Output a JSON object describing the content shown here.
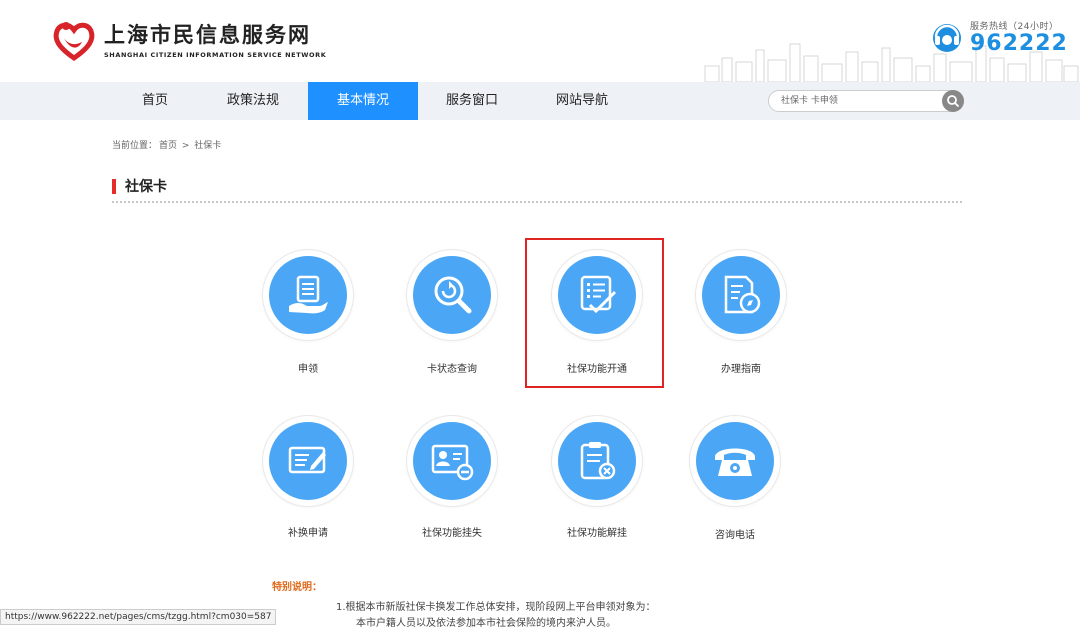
{
  "site": {
    "title_cn": "上海市民信息服务网",
    "title_en": "SHANGHAI CITIZEN INFORMATION SERVICE NETWORK",
    "hotline_label": "服务热线（24小时）",
    "hotline_number": "962222",
    "brand_color": "#1e90ff",
    "logo_color": "#d8232a"
  },
  "nav": {
    "items": [
      {
        "label": "首页",
        "active": false
      },
      {
        "label": "政策法规",
        "active": false
      },
      {
        "label": "基本情况",
        "active": true
      },
      {
        "label": "服务窗口",
        "active": false
      },
      {
        "label": "网站导航",
        "active": false
      }
    ],
    "search_placeholder": "社保卡 卡申领"
  },
  "breadcrumb": {
    "prefix": "当前位置：",
    "home": "首页",
    "sep": " > ",
    "current": "社保卡"
  },
  "section": {
    "title": "社保卡",
    "accent_color": "#e62b2b"
  },
  "services": [
    {
      "label": "申领",
      "icon": "apply-hand-icon"
    },
    {
      "label": "卡状态查询",
      "icon": "search-refresh-icon"
    },
    {
      "label": "社保功能开通",
      "icon": "document-check-icon",
      "highlighted": true
    },
    {
      "label": "办理指南",
      "icon": "guide-compass-icon"
    },
    {
      "label": "补换申请",
      "icon": "card-edit-icon"
    },
    {
      "label": "社保功能挂失",
      "icon": "id-card-minus-icon"
    },
    {
      "label": "社保功能解挂",
      "icon": "clipboard-cancel-icon"
    },
    {
      "label": "咨询电话",
      "icon": "telephone-icon"
    }
  ],
  "notice": {
    "title": "特别说明：",
    "line1": "1.根据本市新版社保卡换发工作总体安排，现阶段网上平台申领对象为：",
    "line2": "本市户籍人员以及依法参加本市社会保险的境内来沪人员。"
  },
  "status_url": "https://www.962222.net/pages/cms/tzgg.html?cm030=587"
}
